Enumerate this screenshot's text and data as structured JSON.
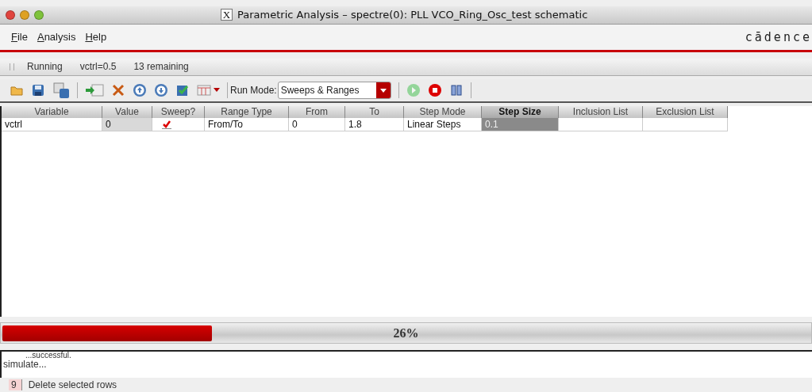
{
  "window": {
    "title": "Parametric Analysis – spectre(0): PLL VCO_Ring_Osc_test schematic",
    "x_badge": "X"
  },
  "menu": [
    "File",
    "Analysis",
    "Help"
  ],
  "logo": "cādence",
  "run_status": {
    "state": "Running",
    "point": "vctrl=0.5",
    "remaining": "13 remaining"
  },
  "toolbar": {
    "tools": [
      {
        "kind": "open"
      },
      {
        "kind": "save"
      },
      {
        "kind": "save-as"
      },
      {
        "kind": "sep"
      },
      {
        "kind": "add-row"
      },
      {
        "kind": "delete"
      },
      {
        "kind": "up"
      },
      {
        "kind": "down"
      },
      {
        "kind": "check"
      },
      {
        "kind": "table"
      },
      {
        "kind": "dropdown"
      },
      {
        "kind": "sep"
      }
    ],
    "run_mode_label": "Run Mode:",
    "run_mode": "Sweeps & Ranges",
    "actions": [
      {
        "kind": "run",
        "disabled": true
      },
      {
        "kind": "stop",
        "disabled": false
      },
      {
        "kind": "pause",
        "disabled": false
      }
    ]
  },
  "table": {
    "columns": [
      {
        "label": "Variable",
        "selected": false
      },
      {
        "label": "Value",
        "selected": false
      },
      {
        "label": "Sweep?",
        "selected": false
      },
      {
        "label": "Range Type",
        "selected": false
      },
      {
        "label": "From",
        "selected": false
      },
      {
        "label": "To",
        "selected": false
      },
      {
        "label": "Step Mode",
        "selected": false
      },
      {
        "label": "Step Size",
        "selected": true
      },
      {
        "label": "Inclusion List",
        "selected": false
      },
      {
        "label": "Exclusion List",
        "selected": false
      }
    ],
    "rows": [
      {
        "variable": "vctrl",
        "value": "0",
        "sweep": true,
        "range_type": "From/To",
        "from": "0",
        "to": "1.8",
        "step_mode": "Linear Steps",
        "step_size": "0.1",
        "step_size_selected": true
      }
    ]
  },
  "progress": {
    "level": 0.26,
    "text": "26%"
  },
  "log": [
    "...successful.",
    "simulate..."
  ],
  "status_bar": {
    "count": "9",
    "message": "Delete selected rows"
  }
}
